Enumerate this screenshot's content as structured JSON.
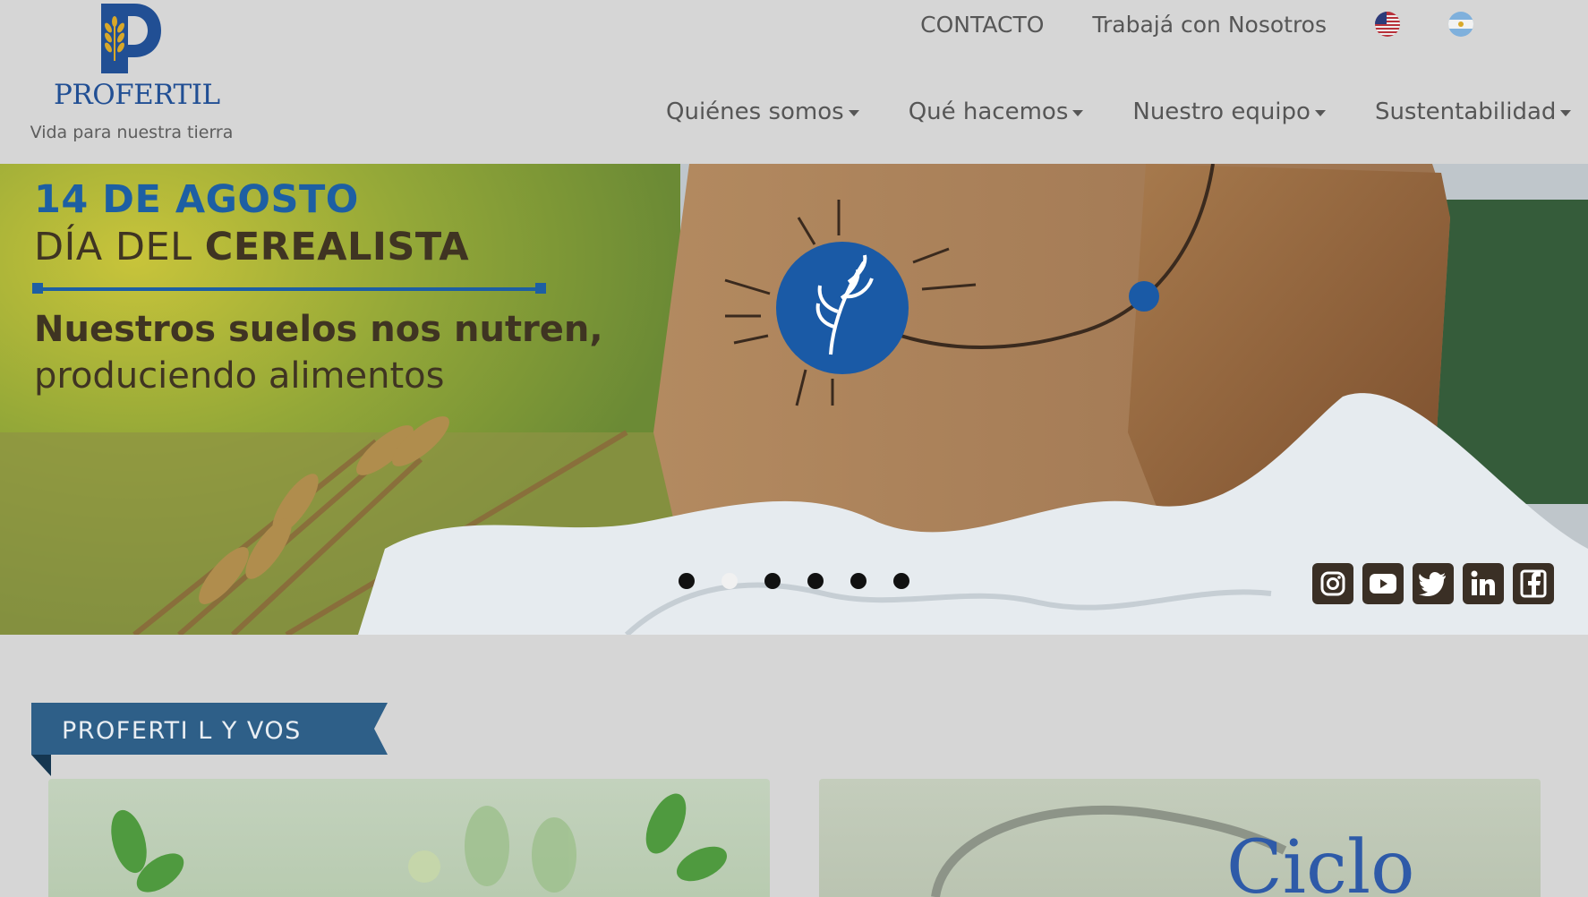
{
  "brand": {
    "name": "PROFERTIL",
    "tagline": "Vida para nuestra tierra",
    "color": "#214f94"
  },
  "topbar": {
    "contact": "CONTACTO",
    "work_with_us": "Trabajá con Nosotros",
    "flags": [
      "us-flag-icon",
      "argentina-flag-icon"
    ]
  },
  "nav": {
    "items": [
      {
        "label": "Quiénes somos"
      },
      {
        "label": "Qué hacemos"
      },
      {
        "label": "Nuestro equipo"
      },
      {
        "label": "Sustentabilidad"
      }
    ]
  },
  "banner": {
    "date": "14 DE AGOSTO",
    "day_prefix": "DÍA DEL ",
    "day_strong": "CEREALISTA",
    "message_strong": "Nuestros suelos nos nutren,",
    "message_rest": "produciendo alimentos",
    "slide_count": 6,
    "active_slide": 2
  },
  "social": [
    "instagram-icon",
    "youtube-icon",
    "twitter-icon",
    "linkedin-icon",
    "facebook-icon"
  ],
  "section": {
    "title": "PROFERTI L Y VOS",
    "ribbon_color": "#2e5f88"
  },
  "cards": [
    {
      "title": ""
    },
    {
      "title": "Ciclo"
    }
  ]
}
